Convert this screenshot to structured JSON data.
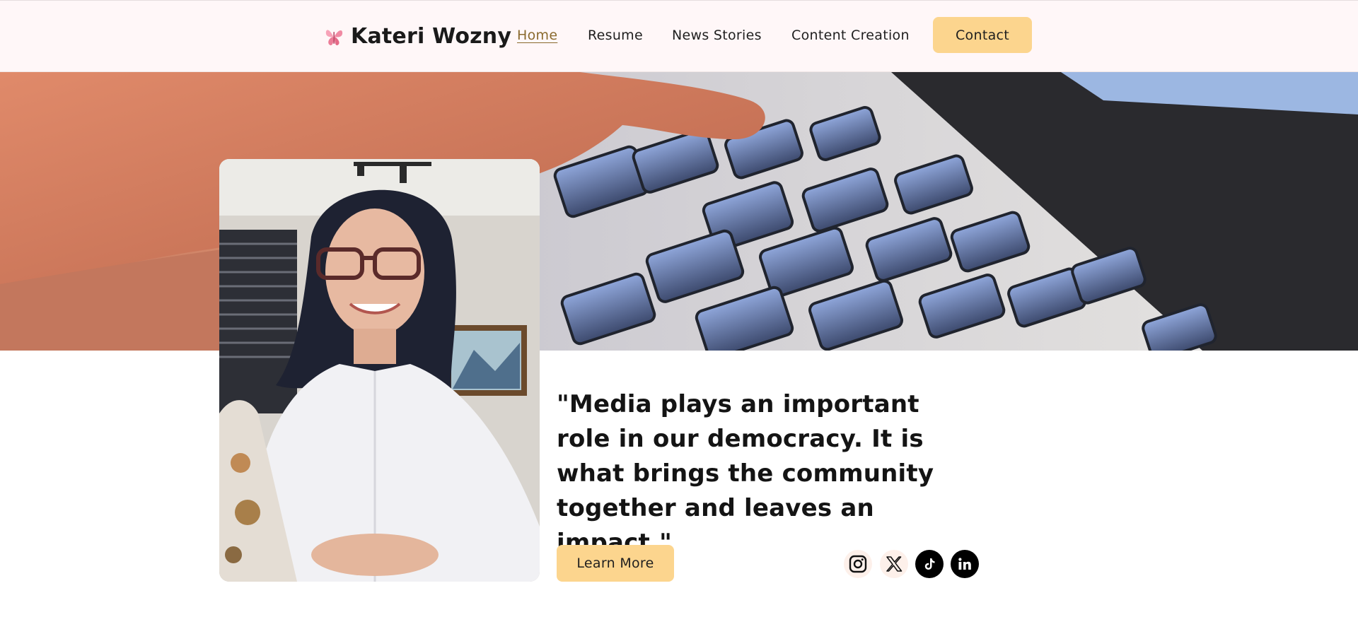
{
  "header": {
    "brand_name": "Kateri Wozny",
    "logo_icon": "butterfly-icon",
    "nav": [
      {
        "label": "Home",
        "active": true
      },
      {
        "label": "Resume",
        "active": false
      },
      {
        "label": "News Stories",
        "active": false
      },
      {
        "label": "Content Creation",
        "active": false
      }
    ],
    "contact_label": "Contact"
  },
  "hero": {
    "background_image": "laptop-keyboard-photo",
    "portrait_image": "kateri-portrait-photo"
  },
  "main": {
    "quote": "\"Media plays an important role in our democracy. It is what brings the community together and leaves an impact.\"",
    "learn_more_label": "Learn More",
    "social": [
      {
        "icon": "instagram-icon"
      },
      {
        "icon": "x-twitter-icon"
      },
      {
        "icon": "tiktok-icon"
      },
      {
        "icon": "linkedin-icon"
      }
    ]
  },
  "colors": {
    "header_bg": "#fff7f8",
    "accent_button": "#fcd58e",
    "active_link": "#8a6a2e",
    "text": "#141414"
  }
}
